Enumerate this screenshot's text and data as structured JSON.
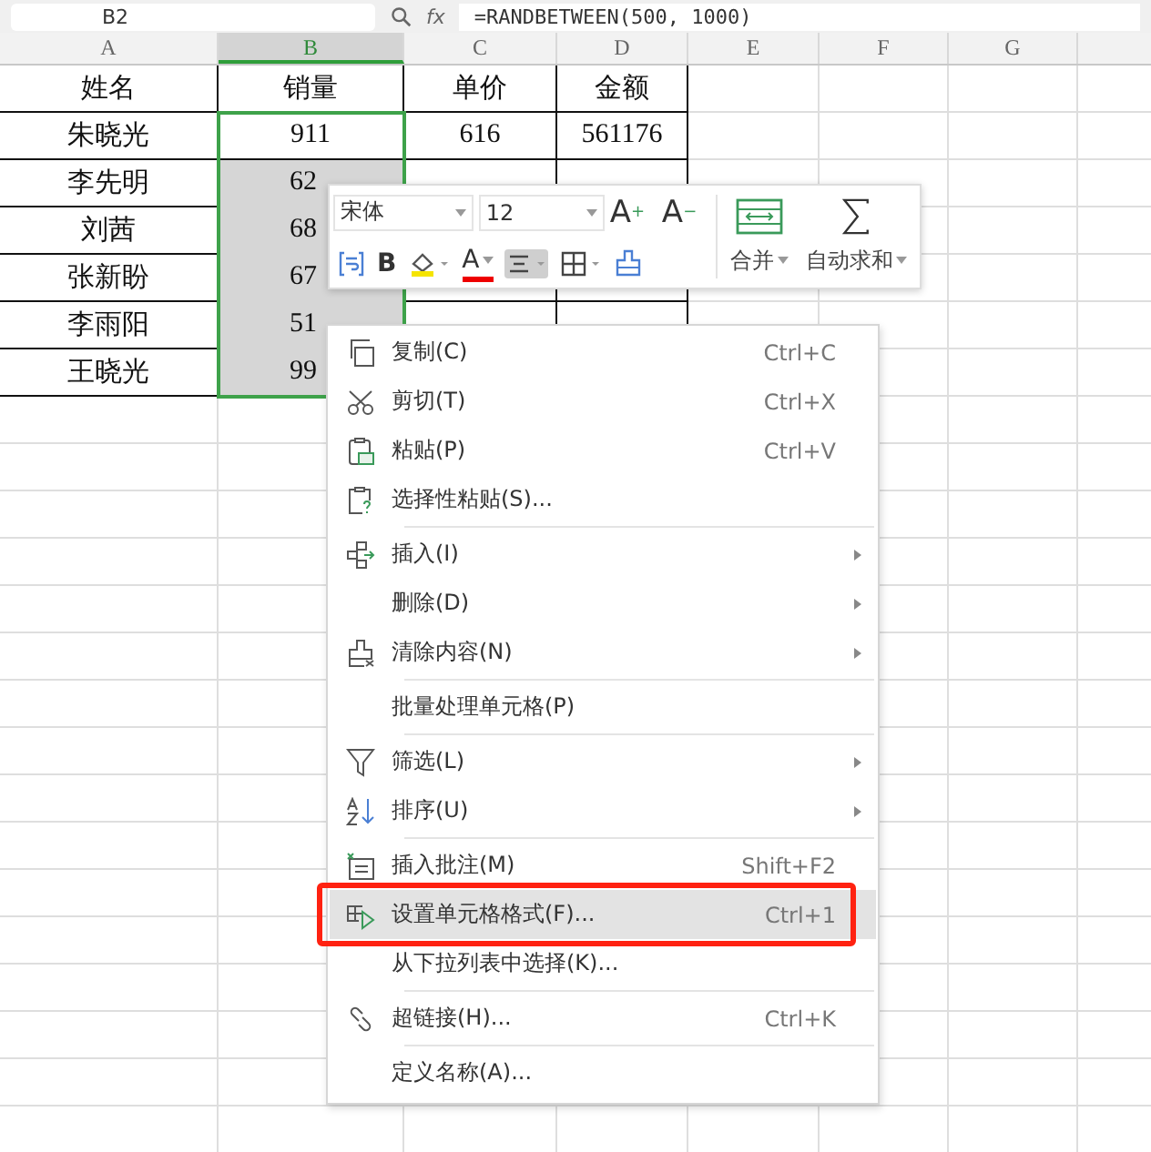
{
  "formula_bar": {
    "name_box": "B2",
    "fx": "fx",
    "formula": "=RANDBETWEEN(500, 1000)"
  },
  "columns": [
    {
      "letter": "A",
      "selected": false
    },
    {
      "letter": "B",
      "selected": true
    },
    {
      "letter": "C",
      "selected": false
    },
    {
      "letter": "D",
      "selected": false
    },
    {
      "letter": "E",
      "selected": false
    },
    {
      "letter": "F",
      "selected": false
    },
    {
      "letter": "G",
      "selected": false
    }
  ],
  "rows": [
    {
      "a": "姓名",
      "b": "销量",
      "c": "单价",
      "d": "金额",
      "b_shaded": false
    },
    {
      "a": "朱晓光",
      "b": "911",
      "c": "616",
      "d": "561176",
      "b_shaded": false
    },
    {
      "a": "李先明",
      "b": "62",
      "b_shaded": true
    },
    {
      "a": "刘茜",
      "b": "68",
      "b_shaded": true
    },
    {
      "a": "张新盼",
      "b": "67",
      "b_shaded": true
    },
    {
      "a": "李雨阳",
      "b": "51",
      "b_shaded": true
    },
    {
      "a": "王晓光",
      "b": "99",
      "b_shaded": true
    }
  ],
  "mini_toolbar": {
    "font": "宋体",
    "size": "12",
    "grow": "A",
    "grow_sign": "+",
    "shrink": "A",
    "shrink_sign": "−",
    "bold": "B",
    "font_color_letter": "A",
    "align_pressed": true,
    "merge": "合并",
    "autosum": "自动求和"
  },
  "menu": [
    {
      "kind": "copy",
      "label": "复制(C)",
      "shortcut": "Ctrl+C",
      "has_submenu": false,
      "selected": false,
      "framed": false
    },
    {
      "kind": "cut",
      "label": "剪切(T)",
      "shortcut": "Ctrl+X",
      "has_submenu": false,
      "selected": false,
      "framed": false
    },
    {
      "kind": "paste",
      "label": "粘贴(P)",
      "shortcut": "Ctrl+V",
      "has_submenu": false,
      "selected": false,
      "framed": false
    },
    {
      "kind": "paste-special",
      "label": "选择性粘贴(S)...",
      "has_submenu": false,
      "selected": false,
      "framed": false
    },
    {
      "kind": "separator"
    },
    {
      "kind": "insert",
      "label": "插入(I)",
      "has_submenu": true,
      "selected": false,
      "framed": false
    },
    {
      "kind": "plain",
      "label": "删除(D)",
      "has_submenu": true,
      "selected": false,
      "framed": false
    },
    {
      "kind": "clear",
      "label": "清除内容(N)",
      "has_submenu": true,
      "selected": false,
      "framed": false
    },
    {
      "kind": "separator"
    },
    {
      "kind": "plain",
      "label": "批量处理单元格(P)",
      "has_submenu": false,
      "selected": false,
      "framed": false
    },
    {
      "kind": "separator"
    },
    {
      "kind": "filter",
      "label": "筛选(L)",
      "has_submenu": true,
      "selected": false,
      "framed": false
    },
    {
      "kind": "sort",
      "label": "排序(U)",
      "has_submenu": true,
      "selected": false,
      "framed": false
    },
    {
      "kind": "separator"
    },
    {
      "kind": "comment",
      "label": "插入批注(M)",
      "shortcut": "Shift+F2",
      "has_submenu": false,
      "selected": false,
      "framed": false
    },
    {
      "kind": "format",
      "label": "设置单元格格式(F)...",
      "shortcut": "Ctrl+1",
      "has_submenu": false,
      "selected": true,
      "framed": true
    },
    {
      "kind": "plain",
      "label": "从下拉列表中选择(K)...",
      "has_submenu": false,
      "selected": false,
      "framed": false
    },
    {
      "kind": "separator"
    },
    {
      "kind": "link",
      "label": "超链接(H)...",
      "shortcut": "Ctrl+K",
      "has_submenu": false,
      "selected": false,
      "framed": false
    },
    {
      "kind": "separator"
    },
    {
      "kind": "plain",
      "label": "定义名称(A)...",
      "has_submenu": false,
      "selected": false,
      "framed": false
    }
  ]
}
